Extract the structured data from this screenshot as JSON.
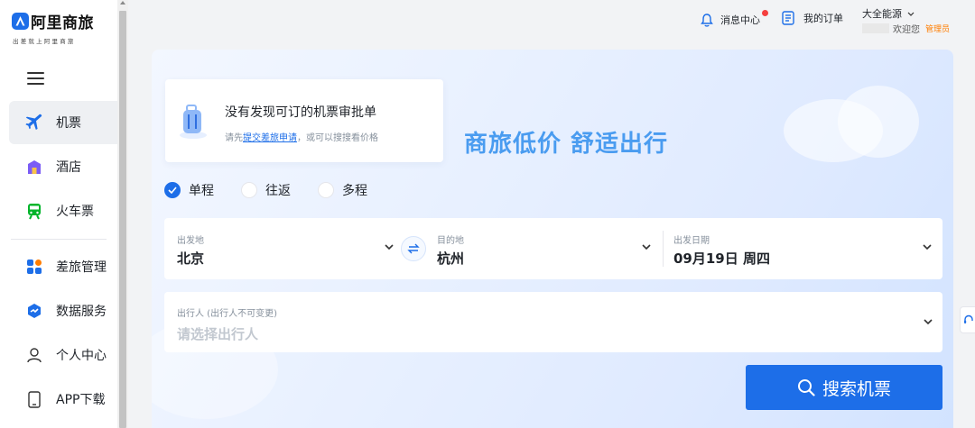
{
  "logo": {
    "name": "阿里商旅",
    "tagline": "出差就上阿里商旅"
  },
  "sidebar": {
    "items": [
      {
        "label": "机票",
        "icon": "plane-icon",
        "active": true
      },
      {
        "label": "酒店",
        "icon": "hotel-icon"
      },
      {
        "label": "火车票",
        "icon": "train-icon"
      },
      {
        "label": "差旅管理",
        "icon": "grid-icon"
      },
      {
        "label": "数据服务",
        "icon": "data-icon"
      },
      {
        "label": "个人中心",
        "icon": "user-icon"
      },
      {
        "label": "APP下载",
        "icon": "phone-icon"
      }
    ]
  },
  "header": {
    "messages": "消息中心",
    "orders": "我的订单",
    "company": "大全能源",
    "welcome": "欢迎您",
    "role": "管理员"
  },
  "notice": {
    "title": "没有发现可订的机票审批单",
    "prefix": "请先",
    "link": "提交差旅申请",
    "suffix": "，或可以搜搜看价格"
  },
  "slogan": "商旅低价 舒适出行",
  "trip_types": [
    "单程",
    "往返",
    "多程"
  ],
  "selected_trip_type": "单程",
  "search": {
    "from_label": "出发地",
    "from_value": "北京",
    "to_label": "目的地",
    "to_value": "杭州",
    "date_label": "出发日期",
    "date_value": "09月19日 周四",
    "traveler_label": "出行人 (出行人不可变更)",
    "traveler_placeholder": "请选择出行人",
    "button": "搜索机票"
  },
  "colors": {
    "brand": "#1d6ee8",
    "slogan": "#4a9cf0",
    "badge": "#f53f3f",
    "role": "#ff7d00"
  }
}
